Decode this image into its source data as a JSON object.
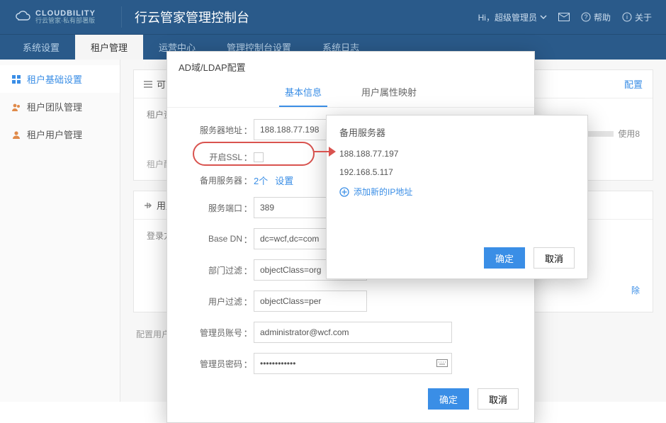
{
  "header": {
    "brand_main": "CLOUDBILITY",
    "brand_sub": "行云管家·私有部署版",
    "title": "行云管家管理控制台",
    "greeting": "Hi，超级管理员",
    "dropdown_icon": "chevron-down",
    "help": "帮助",
    "about": "关于"
  },
  "top_nav": [
    {
      "label": "系统设置",
      "active": false
    },
    {
      "label": "租户管理",
      "active": true
    },
    {
      "label": "运营中心",
      "active": false
    },
    {
      "label": "管理控制台设置",
      "active": false
    },
    {
      "label": "系统日志",
      "active": false
    }
  ],
  "sidebar": {
    "items": [
      {
        "label": "租户基础设置",
        "icon": "grid-icon",
        "active": true
      },
      {
        "label": "租户团队管理",
        "icon": "team-icon",
        "active": false
      },
      {
        "label": "租户用户管理",
        "icon": "user-icon",
        "active": false
      }
    ]
  },
  "panels": {
    "manage": {
      "title": "可管理",
      "config_link": "配置",
      "asset_label": "租户资产",
      "usage_label": "使用8",
      "note": "租户配"
    },
    "login": {
      "title": "用户登",
      "login_mode_label": "登录方式"
    },
    "trail_delete": "除"
  },
  "bottom_note": "配置用户登录方式及各种第三方认证协议",
  "modal": {
    "title": "AD域/LDAP配置",
    "tabs": [
      {
        "label": "基本信息",
        "active": true
      },
      {
        "label": "用户属性映射",
        "active": false
      }
    ],
    "fields": {
      "server_addr": {
        "label": "服务器地址",
        "value": "188.188.77.198"
      },
      "ssl": {
        "label": "开启SSL"
      },
      "backup": {
        "label": "备用服务器",
        "count": "2个",
        "setup": "设置"
      },
      "port": {
        "label": "服务端口",
        "value": "389"
      },
      "base_dn": {
        "label": "Base DN",
        "value": "dc=wcf,dc=com"
      },
      "dept_filter": {
        "label": "部门过滤",
        "value": "objectClass=org"
      },
      "user_filter": {
        "label": "用户过滤",
        "value": "objectClass=per"
      },
      "admin_user": {
        "label": "管理员账号",
        "value": "administrator@wcf.com"
      },
      "admin_pass": {
        "label": "管理员密码",
        "value": "••••••••••••"
      }
    },
    "ok": "确定",
    "cancel": "取消"
  },
  "popover": {
    "title": "备用服务器",
    "ips": [
      "188.188.77.197",
      "192.168.5.117"
    ],
    "add_label": "添加新的IP地址",
    "ok": "确定",
    "cancel": "取消"
  }
}
